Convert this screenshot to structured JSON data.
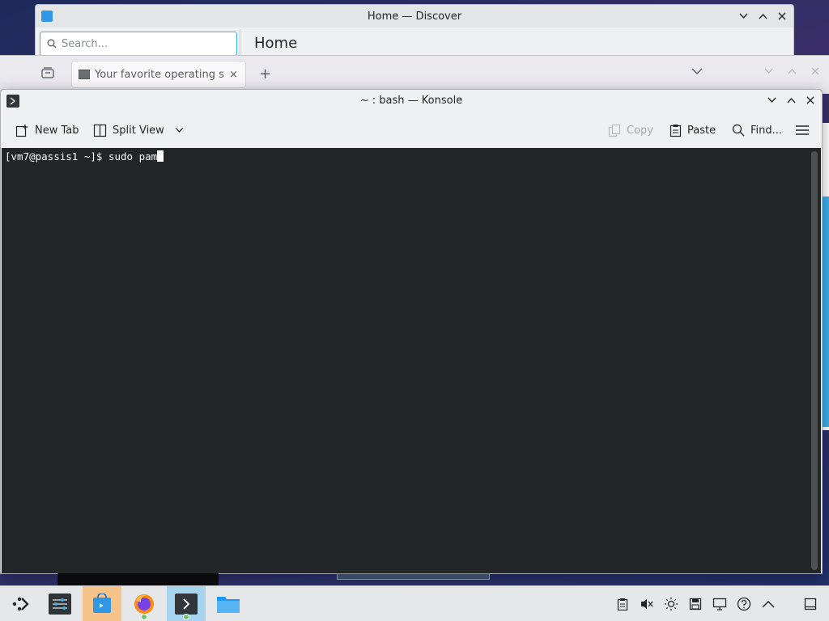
{
  "discover": {
    "title": "Home — Discover",
    "search_placeholder": "Search...",
    "page_title": "Home"
  },
  "firefox": {
    "tab_title": "Your favorite operating sy",
    "tab_close": "×",
    "new_tab": "+"
  },
  "konsole": {
    "title": "~ : bash — Konsole",
    "toolbar": {
      "new_tab": "New Tab",
      "split_view": "Split View",
      "copy": "Copy",
      "paste": "Paste",
      "find": "Find..."
    },
    "terminal": {
      "prompt": "[vm7@passis1 ~]$ ",
      "input": "sudo pam"
    }
  },
  "taskbar": {
    "apps": [
      {
        "name": "application-launcher",
        "icon": "kde-launcher-icon"
      },
      {
        "name": "system-settings",
        "icon": "settings-sliders-icon"
      },
      {
        "name": "discover",
        "icon": "discover-bag-icon",
        "active": true
      },
      {
        "name": "firefox",
        "icon": "firefox-icon"
      },
      {
        "name": "konsole",
        "icon": "terminal-icon",
        "active": true
      },
      {
        "name": "dolphin",
        "icon": "folder-icon"
      }
    ],
    "tray": [
      "clipboard-icon",
      "volume-muted-icon",
      "brightness-icon",
      "disk-icon",
      "display-icon",
      "help-icon",
      "tray-expand-icon",
      "show-desktop-icon"
    ]
  },
  "colors": {
    "accent": "#3daee9",
    "terminal_bg": "#232627",
    "terminal_fg": "#fcfcfc",
    "discover_active": "#f6c38b",
    "konsole_active": "#a6d3ee"
  }
}
